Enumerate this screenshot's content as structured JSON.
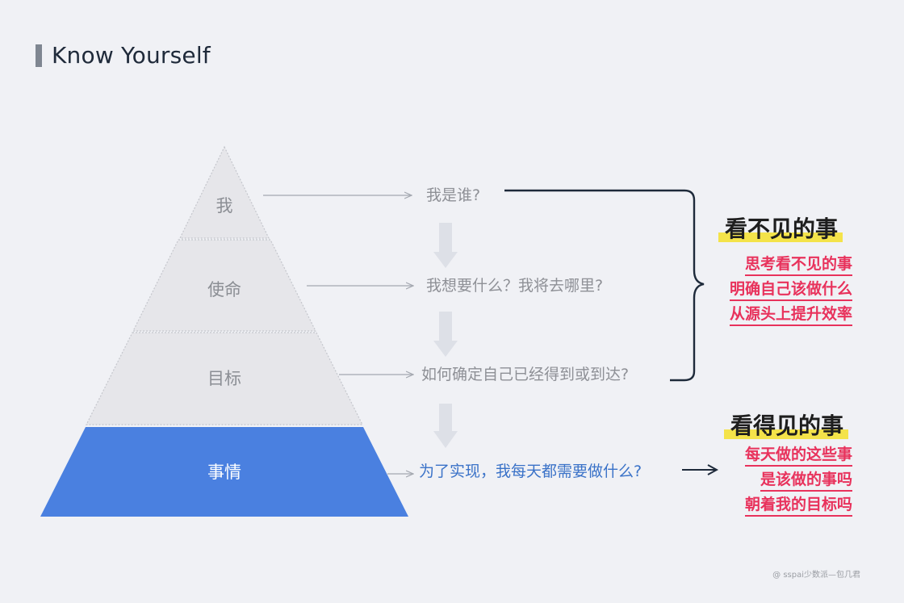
{
  "title": "Know Yourself",
  "pyramid": {
    "levels": [
      {
        "label": "我"
      },
      {
        "label": "使命"
      },
      {
        "label": "目标"
      },
      {
        "label": "事情"
      }
    ]
  },
  "questions": [
    "我是谁?",
    "我想要什么？我将去哪里?",
    "如何确定自己已经得到或到达?",
    "为了实现，我每天都需要做什么?"
  ],
  "invisible": {
    "heading": "看不见的事",
    "items": [
      "思考看不见的事",
      "明确自己该做什么",
      "从源头上提升效率"
    ]
  },
  "visible": {
    "heading": "看得见的事",
    "items": [
      "每天做的这些事",
      "是该做的事吗",
      "朝着我的目标吗"
    ]
  },
  "credit": "@ sspai少数派—包几君",
  "colors": {
    "background": "#f0f1f5",
    "pyramid_gray": "#e6e6ea",
    "pyramid_blue": "#4a80e0",
    "accent_red": "#e8325c",
    "highlight_yellow": "#f4e34a"
  }
}
